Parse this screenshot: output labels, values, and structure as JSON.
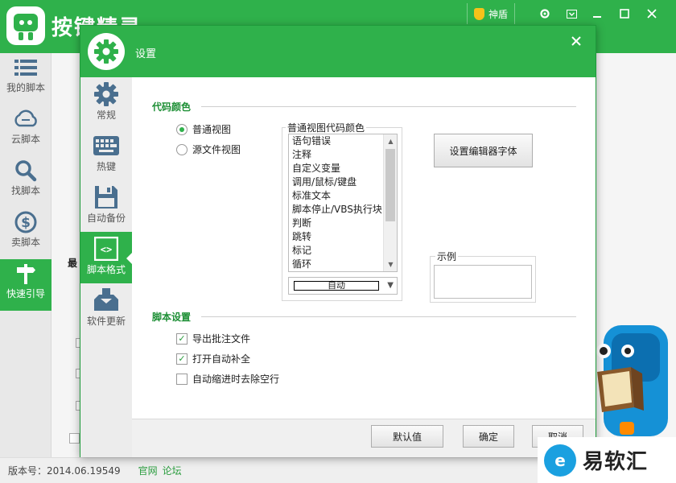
{
  "main": {
    "title": "按键精灵",
    "shendun": "神盾",
    "sidebar": [
      {
        "label": "我的脚本",
        "icon": "list-icon"
      },
      {
        "label": "云脚本",
        "icon": "cloud-icon"
      },
      {
        "label": "找脚本",
        "icon": "search-icon"
      },
      {
        "label": "卖脚本",
        "icon": "dollar-icon"
      },
      {
        "label": "快速引导",
        "icon": "signpost-icon"
      }
    ],
    "content_fragment": "最",
    "status": {
      "version": "版本号：2014.06.19549",
      "link_official": "官网",
      "link_forum": "论坛"
    }
  },
  "dialog": {
    "title": "设置",
    "nav": [
      {
        "label": "常规",
        "icon": "gear-icon"
      },
      {
        "label": "热键",
        "icon": "keyboard-icon"
      },
      {
        "label": "自动备份",
        "icon": "floppy-icon"
      },
      {
        "label": "脚本格式",
        "icon": "code-icon",
        "active": true
      },
      {
        "label": "软件更新",
        "icon": "download-tray-icon"
      }
    ],
    "code_color": {
      "section_title": "代码颜色",
      "radio_normal": "普通视图",
      "radio_source": "源文件视图",
      "selected_view": "普通视图",
      "group_label": "普通视图代码颜色",
      "items": [
        "语句错误",
        "注释",
        "自定义变量",
        "调用/鼠标/键盘",
        "标准文本",
        "脚本停止/VBS执行块",
        "判断",
        "跳转",
        "标记",
        "循环"
      ],
      "combo_value": "自动",
      "font_button": "设置编辑器字体",
      "sample_label": "示例"
    },
    "script_settings": {
      "section_title": "脚本设置",
      "options": [
        {
          "label": "导出批注文件",
          "checked": true
        },
        {
          "label": "打开自动补全",
          "checked": true
        },
        {
          "label": "自动缩进时去除空行",
          "checked": false
        }
      ]
    },
    "buttons": {
      "default": "默认值",
      "ok": "确定",
      "cancel": "取消"
    }
  },
  "watermark": "易软汇",
  "colors": {
    "brand_green": "#2fb14b",
    "section_green": "#1d8f35"
  }
}
